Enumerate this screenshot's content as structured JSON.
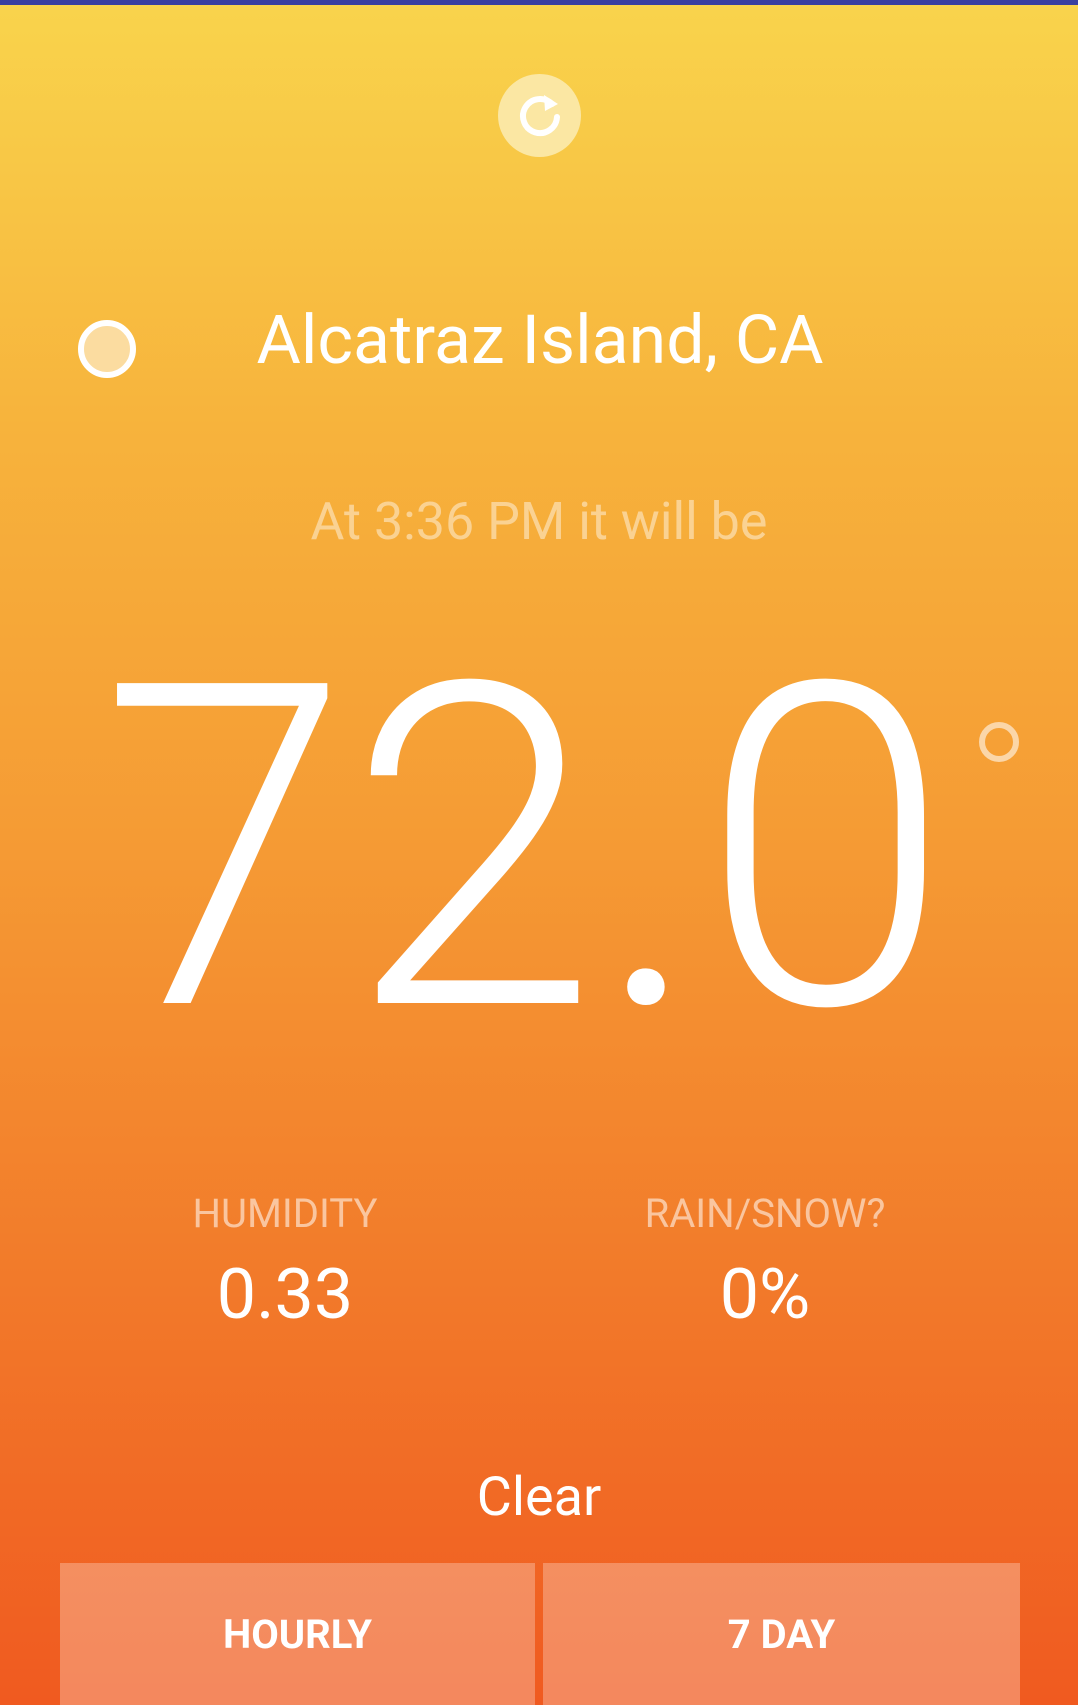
{
  "location": {
    "name": "Alcatraz Island, CA",
    "icon": "location-circle-icon"
  },
  "refresh": {
    "icon": "refresh-icon"
  },
  "forecast": {
    "time_line": "At 3:36 PM it will be",
    "temperature": "72.0",
    "degree_icon": "degree-circle-icon"
  },
  "stats": {
    "humidity_label": "HUMIDITY",
    "humidity_value": "0.33",
    "rain_label": "RAIN/SNOW?",
    "rain_value": "0%"
  },
  "summary": "Clear",
  "buttons": {
    "hourly": "HOURLY",
    "seven_day": "7 DAY"
  },
  "colors": {
    "gradient_top": "#f9d44c",
    "gradient_bottom": "#f05a20",
    "status_bar": "#3a40a0"
  }
}
